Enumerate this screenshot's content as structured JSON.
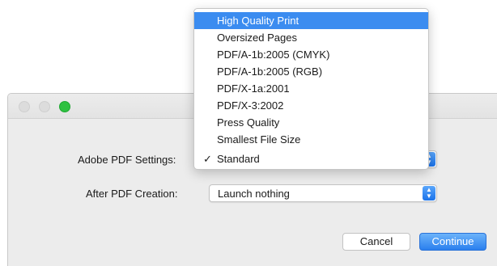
{
  "dialog": {
    "pdf_settings_label": "Adobe PDF Settings:",
    "after_creation_label": "After PDF Creation:",
    "after_creation_value": "Launch nothing",
    "cancel_label": "Cancel",
    "continue_label": "Continue"
  },
  "menu": {
    "items": [
      {
        "label": "High Quality Print",
        "highlighted": true,
        "checked": false
      },
      {
        "label": "Oversized Pages",
        "highlighted": false,
        "checked": false
      },
      {
        "label": "PDF/A-1b:2005 (CMYK)",
        "highlighted": false,
        "checked": false
      },
      {
        "label": "PDF/A-1b:2005 (RGB)",
        "highlighted": false,
        "checked": false
      },
      {
        "label": "PDF/X-1a:2001",
        "highlighted": false,
        "checked": false
      },
      {
        "label": "PDF/X-3:2002",
        "highlighted": false,
        "checked": false
      },
      {
        "label": "Press Quality",
        "highlighted": false,
        "checked": false
      },
      {
        "label": "Smallest File Size",
        "highlighted": false,
        "checked": false
      },
      {
        "label": "Standard",
        "highlighted": false,
        "checked": true
      }
    ],
    "checkmark": "✓"
  },
  "icons": {
    "stepper_up": "▲",
    "stepper_down": "▼"
  },
  "colors": {
    "accent": "#3b8cf0",
    "close_button": "#dcdcdc",
    "zoom_button": "#2fc141"
  }
}
